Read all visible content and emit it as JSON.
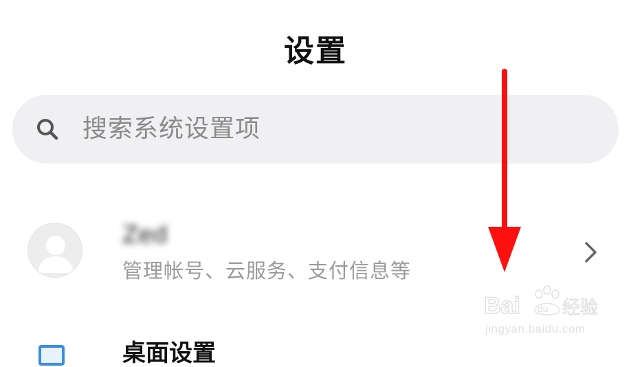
{
  "header": {
    "title": "设置"
  },
  "search": {
    "placeholder": "搜索系统设置项",
    "icon": "search-icon"
  },
  "account": {
    "name": "Zed",
    "subtitle": "管理帐号、云服务、支付信息等",
    "chevron_icon": "chevron-right-icon",
    "avatar_icon": "default-avatar-icon"
  },
  "next_item": {
    "label": "桌面设置",
    "icon": "wallpaper-icon"
  },
  "annotation": {
    "arrow_icon": "red-arrow-down-icon",
    "color": "#ff1010"
  },
  "watermark": {
    "brand": "Bai du 经验",
    "url": "jingyan.baidu.com"
  },
  "colors": {
    "search_background": "#f0f0f2",
    "secondary_text": "#9a9a9a",
    "placeholder_text": "#8a8a8a"
  }
}
